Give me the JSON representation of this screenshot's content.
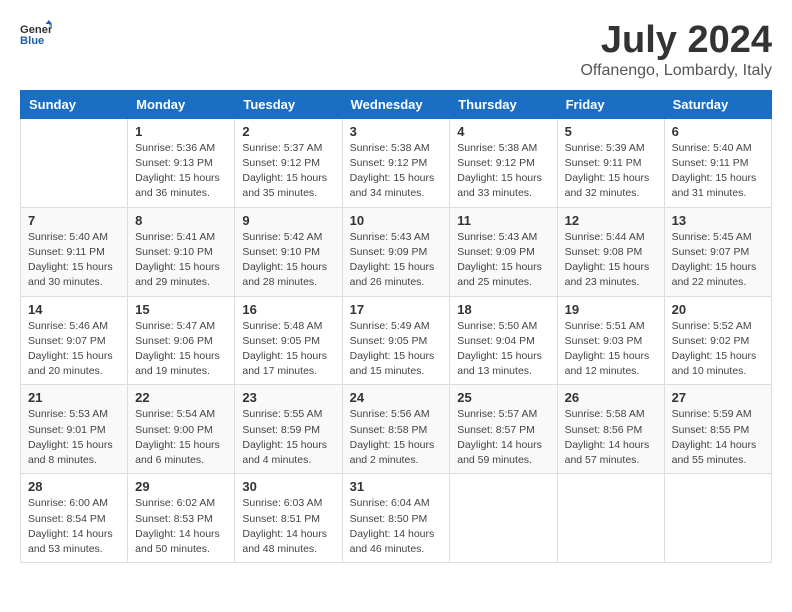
{
  "header": {
    "logo_general": "General",
    "logo_blue": "Blue",
    "month": "July 2024",
    "location": "Offanengo, Lombardy, Italy"
  },
  "weekdays": [
    "Sunday",
    "Monday",
    "Tuesday",
    "Wednesday",
    "Thursday",
    "Friday",
    "Saturday"
  ],
  "weeks": [
    [
      {
        "day": "",
        "info": ""
      },
      {
        "day": "1",
        "info": "Sunrise: 5:36 AM\nSunset: 9:13 PM\nDaylight: 15 hours\nand 36 minutes."
      },
      {
        "day": "2",
        "info": "Sunrise: 5:37 AM\nSunset: 9:12 PM\nDaylight: 15 hours\nand 35 minutes."
      },
      {
        "day": "3",
        "info": "Sunrise: 5:38 AM\nSunset: 9:12 PM\nDaylight: 15 hours\nand 34 minutes."
      },
      {
        "day": "4",
        "info": "Sunrise: 5:38 AM\nSunset: 9:12 PM\nDaylight: 15 hours\nand 33 minutes."
      },
      {
        "day": "5",
        "info": "Sunrise: 5:39 AM\nSunset: 9:11 PM\nDaylight: 15 hours\nand 32 minutes."
      },
      {
        "day": "6",
        "info": "Sunrise: 5:40 AM\nSunset: 9:11 PM\nDaylight: 15 hours\nand 31 minutes."
      }
    ],
    [
      {
        "day": "7",
        "info": "Sunrise: 5:40 AM\nSunset: 9:11 PM\nDaylight: 15 hours\nand 30 minutes."
      },
      {
        "day": "8",
        "info": "Sunrise: 5:41 AM\nSunset: 9:10 PM\nDaylight: 15 hours\nand 29 minutes."
      },
      {
        "day": "9",
        "info": "Sunrise: 5:42 AM\nSunset: 9:10 PM\nDaylight: 15 hours\nand 28 minutes."
      },
      {
        "day": "10",
        "info": "Sunrise: 5:43 AM\nSunset: 9:09 PM\nDaylight: 15 hours\nand 26 minutes."
      },
      {
        "day": "11",
        "info": "Sunrise: 5:43 AM\nSunset: 9:09 PM\nDaylight: 15 hours\nand 25 minutes."
      },
      {
        "day": "12",
        "info": "Sunrise: 5:44 AM\nSunset: 9:08 PM\nDaylight: 15 hours\nand 23 minutes."
      },
      {
        "day": "13",
        "info": "Sunrise: 5:45 AM\nSunset: 9:07 PM\nDaylight: 15 hours\nand 22 minutes."
      }
    ],
    [
      {
        "day": "14",
        "info": "Sunrise: 5:46 AM\nSunset: 9:07 PM\nDaylight: 15 hours\nand 20 minutes."
      },
      {
        "day": "15",
        "info": "Sunrise: 5:47 AM\nSunset: 9:06 PM\nDaylight: 15 hours\nand 19 minutes."
      },
      {
        "day": "16",
        "info": "Sunrise: 5:48 AM\nSunset: 9:05 PM\nDaylight: 15 hours\nand 17 minutes."
      },
      {
        "day": "17",
        "info": "Sunrise: 5:49 AM\nSunset: 9:05 PM\nDaylight: 15 hours\nand 15 minutes."
      },
      {
        "day": "18",
        "info": "Sunrise: 5:50 AM\nSunset: 9:04 PM\nDaylight: 15 hours\nand 13 minutes."
      },
      {
        "day": "19",
        "info": "Sunrise: 5:51 AM\nSunset: 9:03 PM\nDaylight: 15 hours\nand 12 minutes."
      },
      {
        "day": "20",
        "info": "Sunrise: 5:52 AM\nSunset: 9:02 PM\nDaylight: 15 hours\nand 10 minutes."
      }
    ],
    [
      {
        "day": "21",
        "info": "Sunrise: 5:53 AM\nSunset: 9:01 PM\nDaylight: 15 hours\nand 8 minutes."
      },
      {
        "day": "22",
        "info": "Sunrise: 5:54 AM\nSunset: 9:00 PM\nDaylight: 15 hours\nand 6 minutes."
      },
      {
        "day": "23",
        "info": "Sunrise: 5:55 AM\nSunset: 8:59 PM\nDaylight: 15 hours\nand 4 minutes."
      },
      {
        "day": "24",
        "info": "Sunrise: 5:56 AM\nSunset: 8:58 PM\nDaylight: 15 hours\nand 2 minutes."
      },
      {
        "day": "25",
        "info": "Sunrise: 5:57 AM\nSunset: 8:57 PM\nDaylight: 14 hours\nand 59 minutes."
      },
      {
        "day": "26",
        "info": "Sunrise: 5:58 AM\nSunset: 8:56 PM\nDaylight: 14 hours\nand 57 minutes."
      },
      {
        "day": "27",
        "info": "Sunrise: 5:59 AM\nSunset: 8:55 PM\nDaylight: 14 hours\nand 55 minutes."
      }
    ],
    [
      {
        "day": "28",
        "info": "Sunrise: 6:00 AM\nSunset: 8:54 PM\nDaylight: 14 hours\nand 53 minutes."
      },
      {
        "day": "29",
        "info": "Sunrise: 6:02 AM\nSunset: 8:53 PM\nDaylight: 14 hours\nand 50 minutes."
      },
      {
        "day": "30",
        "info": "Sunrise: 6:03 AM\nSunset: 8:51 PM\nDaylight: 14 hours\nand 48 minutes."
      },
      {
        "day": "31",
        "info": "Sunrise: 6:04 AM\nSunset: 8:50 PM\nDaylight: 14 hours\nand 46 minutes."
      },
      {
        "day": "",
        "info": ""
      },
      {
        "day": "",
        "info": ""
      },
      {
        "day": "",
        "info": ""
      }
    ]
  ]
}
